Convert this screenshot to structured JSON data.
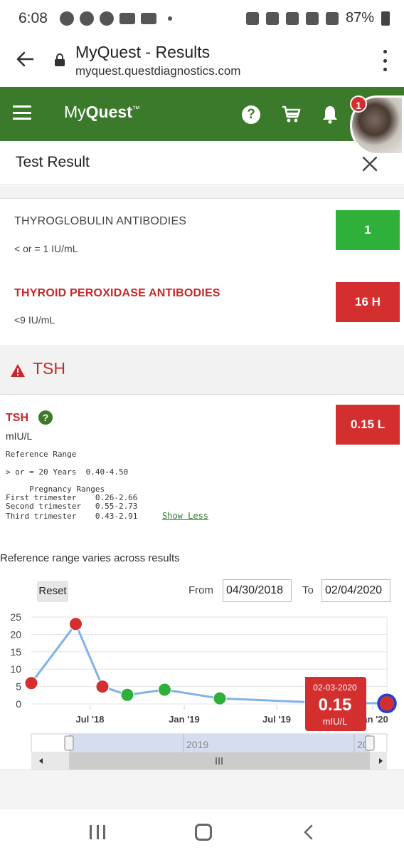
{
  "status_bar": {
    "time": "6:08",
    "battery": "87%"
  },
  "browser": {
    "title": "MyQuest - Results",
    "url": "myquest.questdiagnostics.com"
  },
  "header": {
    "logo_prefix": "My",
    "logo_bold": "Quest",
    "logo_tm": "™",
    "help_glyph": "?",
    "notification_count": "1"
  },
  "page": {
    "title": "Test Result"
  },
  "results": [
    {
      "name": "THYROGLOBULIN ANTIBODIES",
      "range": "< or = 1  IU/mL",
      "value": "1",
      "status": "normal",
      "status_color": "#2fb03a"
    },
    {
      "name": "THYROID PEROXIDASE ANTIBODIES",
      "range": "<9  IU/mL",
      "value": "16 H",
      "status": "high",
      "status_color": "#d32f2f"
    }
  ],
  "tsh_section": {
    "title": "TSH"
  },
  "tsh": {
    "name": "TSH",
    "help_glyph": "?",
    "unit": "mIU/L",
    "value": "0.15 L",
    "reference_label": "Reference Range",
    "reference_adult": "> or = 20 Years  0.40-4.50",
    "pregnancy_header": "     Pregnancy Ranges",
    "first_trimester": "First trimester    0.26-2.66",
    "second_trimester": "Second trimester   0.55-2.73",
    "third_trimester": "Third trimester    0.43-2.91",
    "show_less": "Show Less"
  },
  "chart_controls": {
    "note": "Reference range varies across results",
    "reset": "Reset",
    "from_label": "From",
    "from_date": "04/30/2018",
    "to_label": "To",
    "to_date": "02/04/2020",
    "navigator_label": "2019",
    "navigator_label_partial": "20"
  },
  "chart_data": {
    "type": "line",
    "y_ticks": [
      "25",
      "20",
      "15",
      "10",
      "5",
      "0"
    ],
    "ylim": [
      0,
      25
    ],
    "x_ticks": [
      "Jul '18",
      "Jan '19",
      "Jul '19",
      "Jan '20"
    ],
    "x_tick_fractions": [
      0.165,
      0.43,
      0.69,
      0.96
    ],
    "points": [
      {
        "x_fraction": 0.0,
        "value": 6.0,
        "color": "#d32f2f"
      },
      {
        "x_fraction": 0.125,
        "value": 23.0,
        "color": "#d32f2f"
      },
      {
        "x_fraction": 0.2,
        "value": 5.0,
        "color": "#d32f2f"
      },
      {
        "x_fraction": 0.27,
        "value": 2.6,
        "color": "#2fb03a"
      },
      {
        "x_fraction": 0.375,
        "value": 4.1,
        "color": "#2fb03a"
      },
      {
        "x_fraction": 0.53,
        "value": 1.6,
        "color": "#2fb03a"
      },
      {
        "x_fraction": 0.787,
        "value": 0.5,
        "color": "#2fb03a"
      },
      {
        "x_fraction": 1.0,
        "value": 0.15,
        "color": "#d32f2f",
        "highlighted": true
      }
    ],
    "tooltip": {
      "date": "02-03-2020",
      "value": "0.15",
      "unit": "mIU/L"
    },
    "line_color": "#7fb3e6",
    "grid": true
  }
}
